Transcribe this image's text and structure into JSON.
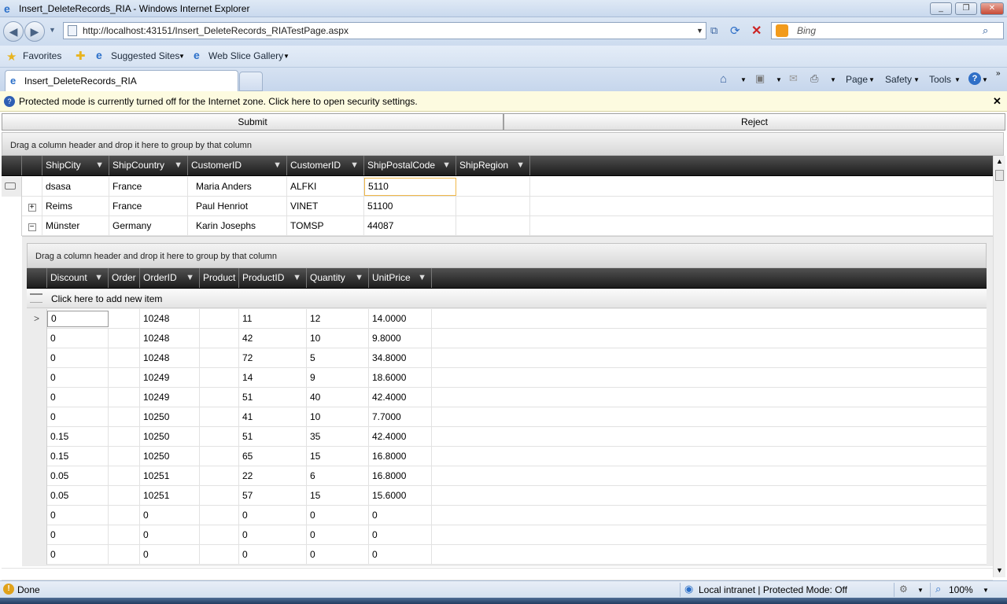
{
  "window": {
    "title": "Insert_DeleteRecords_RIA - Windows Internet Explorer"
  },
  "address": {
    "url": "http://localhost:43151/Insert_DeleteRecords_RIATestPage.aspx"
  },
  "search": {
    "placeholder": "Bing"
  },
  "favorites": {
    "label": "Favorites",
    "suggested": "Suggested Sites",
    "webslice": "Web Slice Gallery"
  },
  "tab": {
    "title": "Insert_DeleteRecords_RIA"
  },
  "commands": {
    "page": "Page",
    "safety": "Safety",
    "tools": "Tools"
  },
  "infobar": {
    "text": "Protected mode is currently turned off for the Internet zone.  Click here to open security settings."
  },
  "toolbar": {
    "submit": "Submit",
    "reject": "Reject"
  },
  "outer_grid": {
    "group_hint": "Drag a column header and drop it here to group by that column",
    "columns": [
      "ShipCity",
      "ShipCountry",
      "CustomerID",
      "CustomerID",
      "ShipPostalCode",
      "ShipRegion"
    ],
    "rows": [
      {
        "expander": "",
        "cells": [
          "dsasa",
          "France",
          "Maria Anders",
          "ALFKI",
          "5110",
          ""
        ]
      },
      {
        "expander": "+",
        "cells": [
          "Reims",
          "France",
          "Paul Henriot",
          "VINET",
          "51100",
          ""
        ]
      },
      {
        "expander": "−",
        "cells": [
          "Münster",
          "Germany",
          "Karin Josephs",
          "TOMSP",
          "44087",
          ""
        ]
      }
    ]
  },
  "inner_grid": {
    "group_hint": "Drag a column header and drop it here to group by that column",
    "add_new": "Click here to add new item",
    "columns": [
      "Discount",
      "Order",
      "OrderID",
      "Product",
      "ProductID",
      "Quantity",
      "UnitPrice"
    ],
    "rows": [
      [
        "0",
        "",
        "10248",
        "",
        "11",
        "12",
        "14.0000"
      ],
      [
        "0",
        "",
        "10248",
        "",
        "42",
        "10",
        "9.8000"
      ],
      [
        "0",
        "",
        "10248",
        "",
        "72",
        "5",
        "34.8000"
      ],
      [
        "0",
        "",
        "10249",
        "",
        "14",
        "9",
        "18.6000"
      ],
      [
        "0",
        "",
        "10249",
        "",
        "51",
        "40",
        "42.4000"
      ],
      [
        "0",
        "",
        "10250",
        "",
        "41",
        "10",
        "7.7000"
      ],
      [
        "0.15",
        "",
        "10250",
        "",
        "51",
        "35",
        "42.4000"
      ],
      [
        "0.15",
        "",
        "10250",
        "",
        "65",
        "15",
        "16.8000"
      ],
      [
        "0.05",
        "",
        "10251",
        "",
        "22",
        "6",
        "16.8000"
      ],
      [
        "0.05",
        "",
        "10251",
        "",
        "57",
        "15",
        "15.6000"
      ],
      [
        "0",
        "",
        "0",
        "",
        "0",
        "0",
        "0"
      ],
      [
        "0",
        "",
        "0",
        "",
        "0",
        "0",
        "0"
      ],
      [
        "0",
        "",
        "0",
        "",
        "0",
        "0",
        "0"
      ]
    ]
  },
  "status": {
    "text": "Done",
    "zone": "Local intranet | Protected Mode: Off",
    "zoom": "100%"
  },
  "colors": {
    "header_dark": "#1c1c1c",
    "selection_border": "#f0b84a",
    "infobar_bg": "#fdfbe0"
  }
}
